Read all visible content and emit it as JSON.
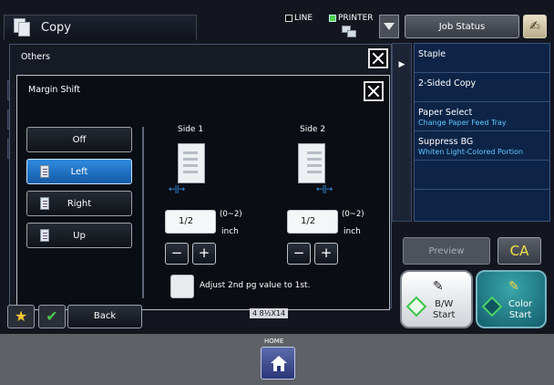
{
  "header": {
    "title": "Copy",
    "line_label": "LINE",
    "printer_label": "PRINTER",
    "job_status": "Job Status"
  },
  "right_panel": {
    "items": [
      {
        "label": "Staple",
        "sub": ""
      },
      {
        "label": "2-Sided Copy",
        "sub": ""
      },
      {
        "label": "Paper Select",
        "sub": "Change Paper Feed Tray"
      },
      {
        "label": "Suppress BG",
        "sub": "Whiten Light-Colored Portion"
      },
      {
        "label": "",
        "sub": ""
      },
      {
        "label": "",
        "sub": ""
      }
    ],
    "preview": "Preview",
    "ca": "CA",
    "bw_start": {
      "line1": "B/W",
      "line2": "Start"
    },
    "color_start": {
      "line1": "Color",
      "line2": "Start"
    }
  },
  "others_dialog": {
    "title": "Others"
  },
  "margin_dialog": {
    "title": "Margin Shift",
    "options": [
      {
        "label": "Off",
        "selected": false
      },
      {
        "label": "Left",
        "selected": true
      },
      {
        "label": "Right",
        "selected": false
      },
      {
        "label": "Up",
        "selected": false
      }
    ],
    "side1": {
      "title": "Side 1",
      "value": "1/2",
      "range": "(0~2)",
      "unit": "inch"
    },
    "side2": {
      "title": "Side 2",
      "value": "1/2",
      "range": "(0~2)",
      "unit": "inch"
    },
    "adjust_label": "Adjust 2nd pg value to 1st.",
    "adjust_checked": false
  },
  "bottom": {
    "back": "Back",
    "paper_size": "4 8½X14"
  },
  "home": {
    "label": "HOME"
  },
  "colors": {
    "selected_option": "#2e8be0",
    "right_panel_bg": "#0d2447",
    "sub_text": "#5ec8ff",
    "ca_text": "#f2e14a"
  }
}
